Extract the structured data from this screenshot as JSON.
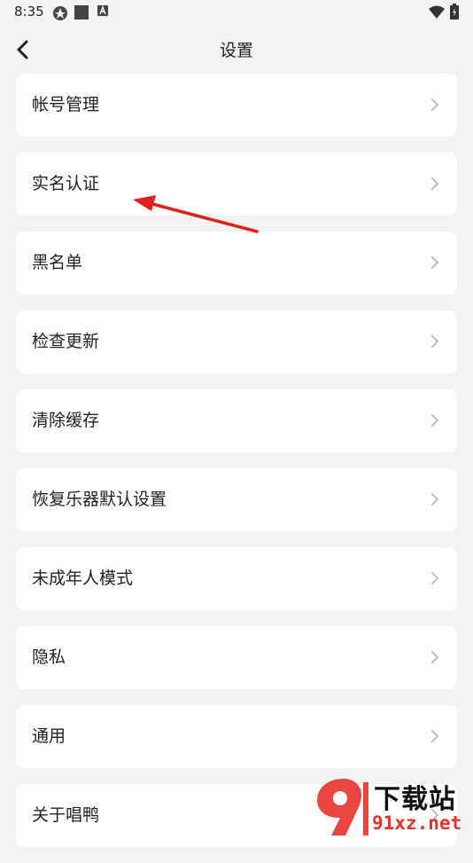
{
  "status_bar": {
    "time": "8:35",
    "icons": [
      "gear-like-app-icon",
      "square-notification-icon",
      "a-notification-icon",
      "wifi-icon",
      "battery-icon"
    ]
  },
  "header": {
    "title": "设置",
    "back_icon": "chevron-left-icon"
  },
  "settings": {
    "items": [
      {
        "label": "帐号管理"
      },
      {
        "label": "实名认证"
      },
      {
        "label": "黑名单"
      },
      {
        "label": "检查更新"
      },
      {
        "label": "清除缓存"
      },
      {
        "label": "恢复乐器默认设置"
      },
      {
        "label": "未成年人模式"
      },
      {
        "label": "隐私"
      },
      {
        "label": "通用"
      },
      {
        "label": "关于唱鸭"
      }
    ]
  },
  "colors": {
    "background": "#f3f3f3",
    "card": "#ffffff",
    "text": "#222222",
    "chevron": "#bdbdbd",
    "annotation_arrow": "#e0201c",
    "watermark_red": "#e8322b"
  },
  "watermark": {
    "brand": "下载站",
    "site": "91xz.net"
  }
}
